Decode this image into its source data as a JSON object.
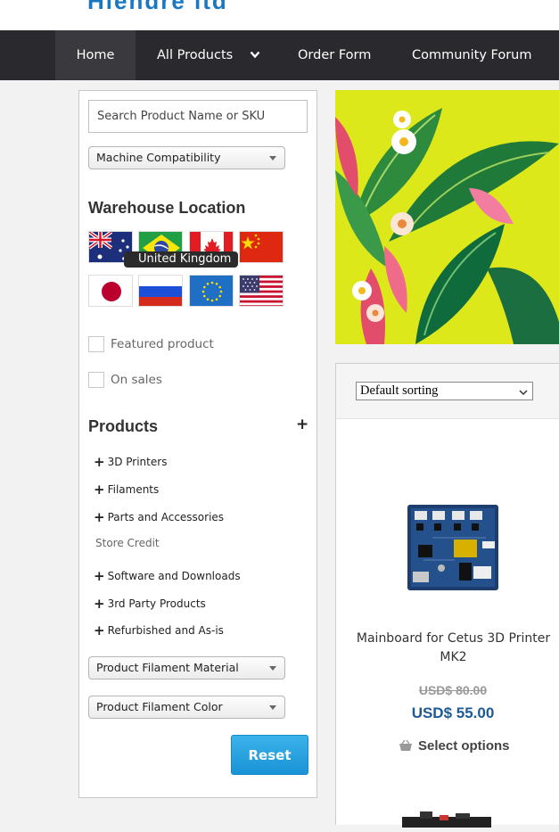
{
  "header": {
    "logo_fragment": "Hiendre ltd"
  },
  "nav": {
    "home": "Home",
    "all_products": "All Products",
    "order_form": "Order Form",
    "community_forum": "Community Forum"
  },
  "sidebar": {
    "search_placeholder": "Search Product Name or SKU",
    "machine_compat": "Machine Compatibility",
    "warehouse_title": "Warehouse Location",
    "flags": [
      "Australia",
      "Brazil",
      "Canada",
      "China",
      "Japan",
      "Russia",
      "European Union",
      "United States"
    ],
    "tooltip": "United Kingdom",
    "featured_label": "Featured product",
    "on_sales_label": "On sales",
    "products_title": "Products",
    "categories": [
      "3D Printers",
      "Filaments",
      "Parts and Accessories",
      "Store Credit",
      "Software and Downloads",
      "3rd Party Products",
      "Refurbished and As-is"
    ],
    "filament_material": "Product Filament Material",
    "filament_color": "Product Filament Color",
    "reset": "Reset"
  },
  "catalog": {
    "sorting": "Default sorting",
    "product": {
      "name": "Mainboard for Cetus 3D Printer MK2",
      "old_price": "USD$ 80.00",
      "new_price": "USD$ 55.00",
      "action": "Select options"
    }
  },
  "colors": {
    "nav_bg": "#2a2a2e",
    "accent_blue": "#1a93d6",
    "price_blue": "#1d5a93",
    "banner_bg": "#dde81b"
  }
}
